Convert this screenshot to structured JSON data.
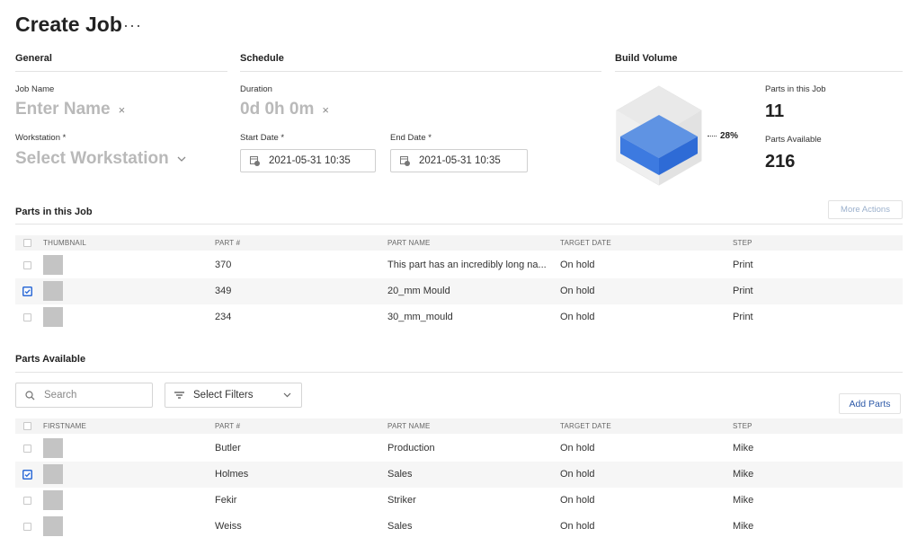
{
  "page": {
    "title": "Create Job",
    "more_icon": "more-horizontal-icon"
  },
  "general": {
    "heading": "General",
    "job_name_label": "Job Name",
    "job_name_placeholder": "Enter Name",
    "clear_glyph": "×",
    "workstation_label": "Workstation *",
    "workstation_placeholder": "Select Workstation"
  },
  "schedule": {
    "heading": "Schedule",
    "duration_label": "Duration",
    "duration_value": "0d 0h 0m",
    "clear_glyph": "×",
    "start_label": "Start Date *",
    "start_value": "2021-05-31 10:35",
    "end_label": "End Date *",
    "end_value": "2021-05-31 10:35"
  },
  "build_volume": {
    "heading": "Build Volume",
    "percent": "28%",
    "fill_fraction": 0.28,
    "parts_in_job_label": "Parts in this Job",
    "parts_in_job_value": "11",
    "parts_available_label": "Parts Available",
    "parts_available_value": "216",
    "colors": {
      "fill_top": "#5f93e3",
      "fill_side": "#2e6bd6",
      "shell": "#e6e6e6"
    }
  },
  "parts_in_job": {
    "heading": "Parts in this Job",
    "more_actions": "More Actions",
    "columns": [
      "THUMBNAIL",
      "PART #",
      "PART NAME",
      "TARGET DATE",
      "STEP"
    ],
    "rows": [
      {
        "part": "370",
        "name": "This part has an incredibly long na...",
        "date": "On hold",
        "step": "Print",
        "checked": false
      },
      {
        "part": "349",
        "name": "20_mm Mould",
        "date": "On hold",
        "step": "Print",
        "checked": true
      },
      {
        "part": "234",
        "name": "30_mm_mould",
        "date": "On hold",
        "step": "Print",
        "checked": false
      }
    ]
  },
  "parts_available": {
    "heading": "Parts Available",
    "search_placeholder": "Search",
    "filter_label": "Select Filters",
    "add_parts": "Add Parts",
    "columns": [
      "FIRSTNAME",
      "PART #",
      "PART NAME",
      "TARGET DATE",
      "STEP"
    ],
    "rows": [
      {
        "part": "Butler",
        "name": "Production",
        "date": "On hold",
        "step": "Mike",
        "checked": false
      },
      {
        "part": "Holmes",
        "name": "Sales",
        "date": "On hold",
        "step": "Mike",
        "checked": true
      },
      {
        "part": "Fekir",
        "name": "Striker",
        "date": "On hold",
        "step": "Mike",
        "checked": false
      },
      {
        "part": "Weiss",
        "name": "Sales",
        "date": "On hold",
        "step": "Mike",
        "checked": false
      }
    ]
  },
  "colors": {
    "accent": "#2e6bd6",
    "link": "#2e5aa8"
  }
}
